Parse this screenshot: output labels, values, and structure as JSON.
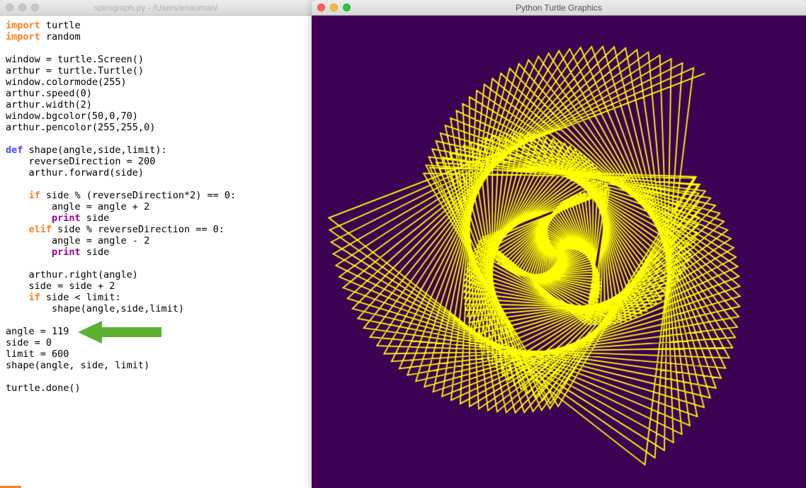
{
  "editor_window": {
    "title": "spirograph.py - /Users/enauman/",
    "traffic_lights": [
      "close",
      "minimize",
      "zoom"
    ],
    "active": false
  },
  "turtle_window": {
    "title": "Python Turtle Graphics",
    "traffic_lights": [
      "close",
      "minimize",
      "zoom"
    ],
    "active": true
  },
  "code": {
    "lines": [
      [
        [
          "kw-import",
          "import"
        ],
        [
          "",
          " turtle"
        ]
      ],
      [
        [
          "kw-import",
          "import"
        ],
        [
          "",
          " random"
        ]
      ],
      [
        [
          "",
          ""
        ]
      ],
      [
        [
          "",
          "window = turtle.Screen()"
        ]
      ],
      [
        [
          "",
          "arthur = turtle.Turtle()"
        ]
      ],
      [
        [
          "",
          "window.colormode(255)"
        ]
      ],
      [
        [
          "",
          "arthur.speed(0)"
        ]
      ],
      [
        [
          "",
          "arthur.width(2)"
        ]
      ],
      [
        [
          "",
          "window.bgcolor(50,0,70)"
        ]
      ],
      [
        [
          "",
          "arthur.pencolor(255,255,0)"
        ]
      ],
      [
        [
          "",
          ""
        ]
      ],
      [
        [
          "kw-def",
          "def"
        ],
        [
          "",
          " shape(angle,side,limit):"
        ]
      ],
      [
        [
          "",
          "    reverseDirection = 200"
        ]
      ],
      [
        [
          "",
          "    arthur.forward(side)"
        ]
      ],
      [
        [
          "",
          ""
        ]
      ],
      [
        [
          "",
          "    "
        ],
        [
          "kw-flow",
          "if"
        ],
        [
          "",
          " side % (reverseDirection*2) == 0:"
        ]
      ],
      [
        [
          "",
          "        angle = angle + 2"
        ]
      ],
      [
        [
          "",
          "        "
        ],
        [
          "kw-print",
          "print"
        ],
        [
          "",
          " side"
        ]
      ],
      [
        [
          "",
          "    "
        ],
        [
          "kw-flow",
          "elif"
        ],
        [
          "",
          " side % reverseDirection == 0:"
        ]
      ],
      [
        [
          "",
          "        angle = angle - 2"
        ]
      ],
      [
        [
          "",
          "        "
        ],
        [
          "kw-print",
          "print"
        ],
        [
          "",
          " side"
        ]
      ],
      [
        [
          "",
          ""
        ]
      ],
      [
        [
          "",
          "    arthur.right(angle)"
        ]
      ],
      [
        [
          "",
          "    side = side + 2"
        ]
      ],
      [
        [
          "",
          "    "
        ],
        [
          "kw-flow",
          "if"
        ],
        [
          "",
          " side < limit:"
        ]
      ],
      [
        [
          "",
          "        shape(angle,side,limit)"
        ]
      ],
      [
        [
          "",
          ""
        ]
      ],
      [
        [
          "",
          "angle = 119"
        ]
      ],
      [
        [
          "",
          "side = 0"
        ]
      ],
      [
        [
          "",
          "limit = 600"
        ]
      ],
      [
        [
          "",
          "shape(angle, side, limit)"
        ]
      ],
      [
        [
          "",
          ""
        ]
      ],
      [
        [
          "",
          "turtle.done()"
        ]
      ]
    ]
  },
  "turtle_params": {
    "angle": 119,
    "side": 0,
    "limit": 600,
    "bgcolor": "#3d0052",
    "pencolor": "#ffff00",
    "penwidth": 2,
    "reverseDirection": 200,
    "canvas_size": 667
  },
  "annotation": {
    "arrow_color": "#5cb032"
  }
}
